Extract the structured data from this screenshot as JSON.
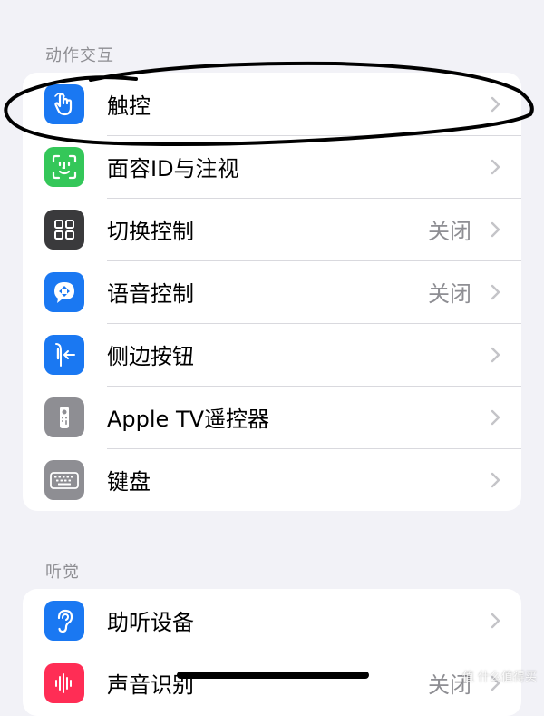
{
  "sections": [
    {
      "header": "动作交互",
      "rows": [
        {
          "label": "触控",
          "value": "",
          "icon": "touch-hand-icon",
          "icon_bg": "#1a78f2"
        },
        {
          "label": "面容ID与注视",
          "value": "",
          "icon": "face-id-icon",
          "icon_bg": "#34c759"
        },
        {
          "label": "切换控制",
          "value": "关闭",
          "icon": "switch-control-icon",
          "icon_bg": "#3a3a3c"
        },
        {
          "label": "语音控制",
          "value": "关闭",
          "icon": "voice-control-icon",
          "icon_bg": "#1a78f2"
        },
        {
          "label": "侧边按钮",
          "value": "",
          "icon": "side-button-icon",
          "icon_bg": "#1a78f2"
        },
        {
          "label": "Apple TV遥控器",
          "value": "",
          "icon": "apple-tv-remote-icon",
          "icon_bg": "#8e8e93"
        },
        {
          "label": "键盘",
          "value": "",
          "icon": "keyboard-icon",
          "icon_bg": "#8e8e93"
        }
      ]
    },
    {
      "header": "听觉",
      "rows": [
        {
          "label": "助听设备",
          "value": "",
          "icon": "hearing-ear-icon",
          "icon_bg": "#1a78f2"
        },
        {
          "label": "声音识别",
          "value": "关闭",
          "icon": "sound-recognition-icon",
          "icon_bg": "#ff2d55"
        }
      ]
    }
  ],
  "watermark": "值 什么值得买",
  "colors": {
    "background": "#f2f2f7",
    "card": "#ffffff",
    "secondary_text": "#8e8e93",
    "annotation_stroke": "#000000"
  }
}
